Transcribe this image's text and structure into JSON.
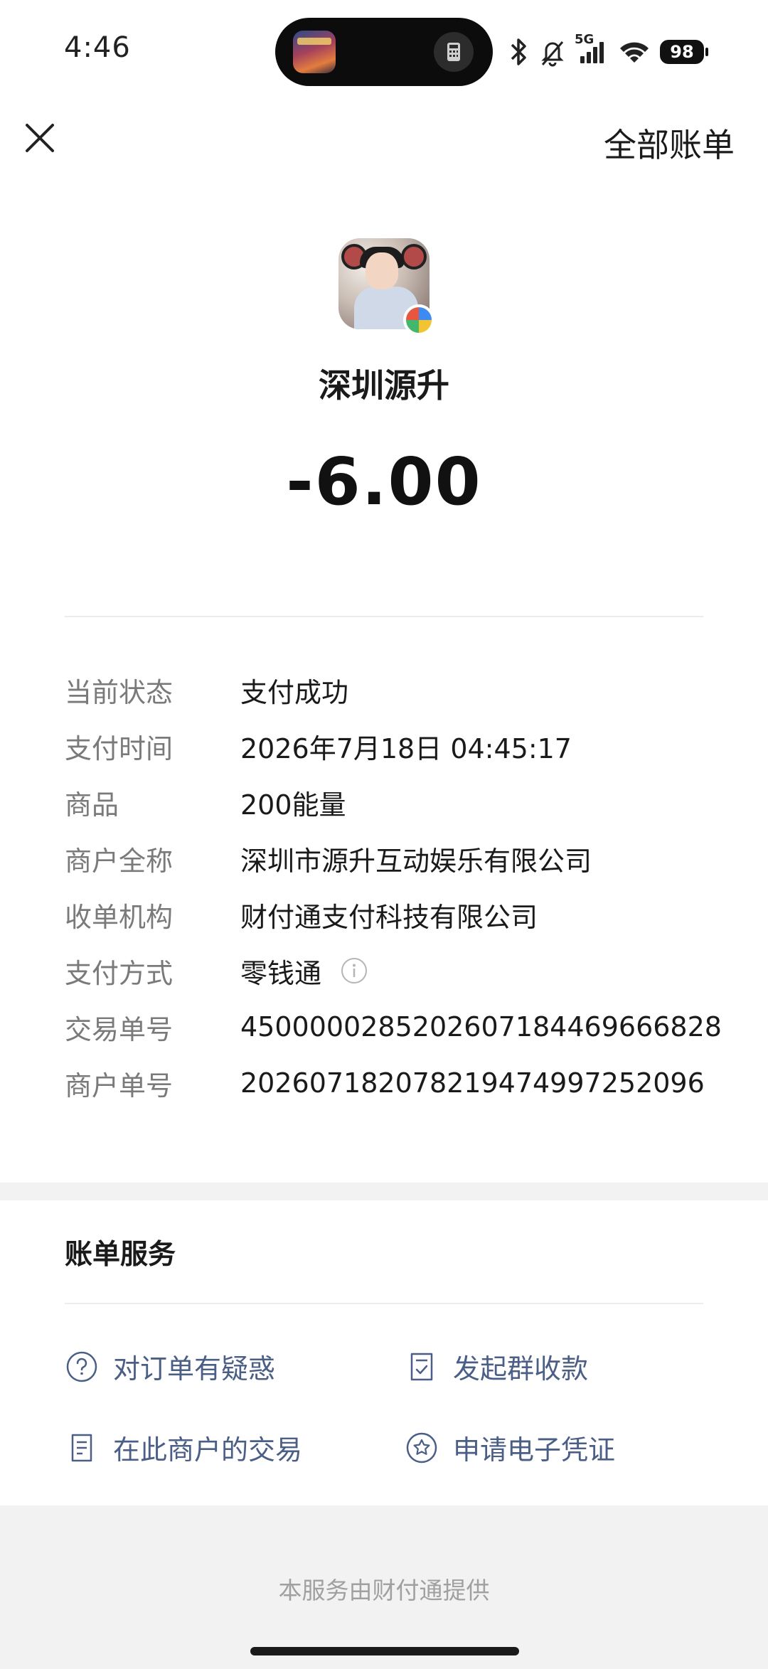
{
  "status_bar": {
    "time": "4:46",
    "network": "5G",
    "battery": "98",
    "icons": [
      "bluetooth-icon",
      "silent-bell-icon",
      "signal-icon",
      "wifi-icon",
      "battery-icon"
    ]
  },
  "nav": {
    "close_icon": "close-icon",
    "all_bills": "全部账单"
  },
  "merchant": {
    "name": "深圳源升",
    "amount": "-6.00"
  },
  "details": [
    {
      "label": "当前状态",
      "value": "支付成功"
    },
    {
      "label": "支付时间",
      "value": "2026年7月18日 04:45:17"
    },
    {
      "label": "商品",
      "value": "200能量"
    },
    {
      "label": "商户全称",
      "value": "深圳市源升互动娱乐有限公司"
    },
    {
      "label": "收单机构",
      "value": "财付通支付科技有限公司"
    },
    {
      "label": "支付方式",
      "value": "零钱通"
    },
    {
      "label": "交易单号",
      "value": "4500000285202607184469666828"
    },
    {
      "label": "商户单号",
      "value": "202607182078219474997252096"
    }
  ],
  "services": {
    "title": "账单服务",
    "items": [
      {
        "label": "对订单有疑惑",
        "icon": "question-circle-icon"
      },
      {
        "label": "发起群收款",
        "icon": "checklist-icon"
      },
      {
        "label": "在此商户的交易",
        "icon": "document-icon"
      },
      {
        "label": "申请电子凭证",
        "icon": "star-badge-icon"
      }
    ]
  },
  "footer": {
    "text": "本服务由财付通提供"
  },
  "colors": {
    "link": "#4b5f86",
    "label": "#7a7a7a",
    "background_band": "#f2f2f2"
  }
}
